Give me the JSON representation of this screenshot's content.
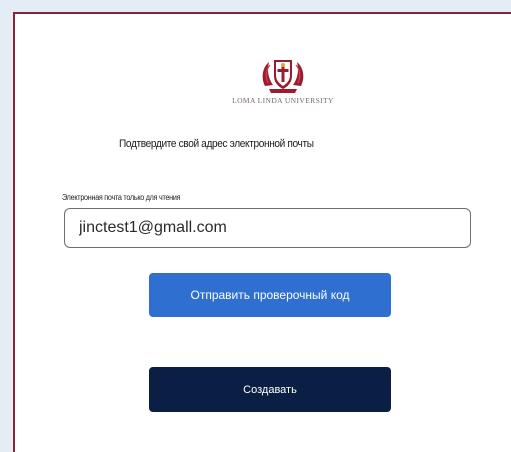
{
  "logo": {
    "icon": "university-crest-icon",
    "text": "LOMA LINDA UNIVERSITY",
    "colors": {
      "crest": "#9e1b2f",
      "accent": "#d6a93a"
    }
  },
  "page": {
    "heading": "Подтвердите свой адрес электронной почты",
    "border_color": "#8a2236",
    "background_color": "#e4ecf6"
  },
  "email": {
    "label": "Электронная почта только для чтения",
    "value": "jinctest1@gmall.com"
  },
  "buttons": {
    "send_code_label": "Отправить проверочный код",
    "send_code_color": "#2e6fd0",
    "create_label": "Создавать",
    "create_color": "#0b1f44"
  }
}
